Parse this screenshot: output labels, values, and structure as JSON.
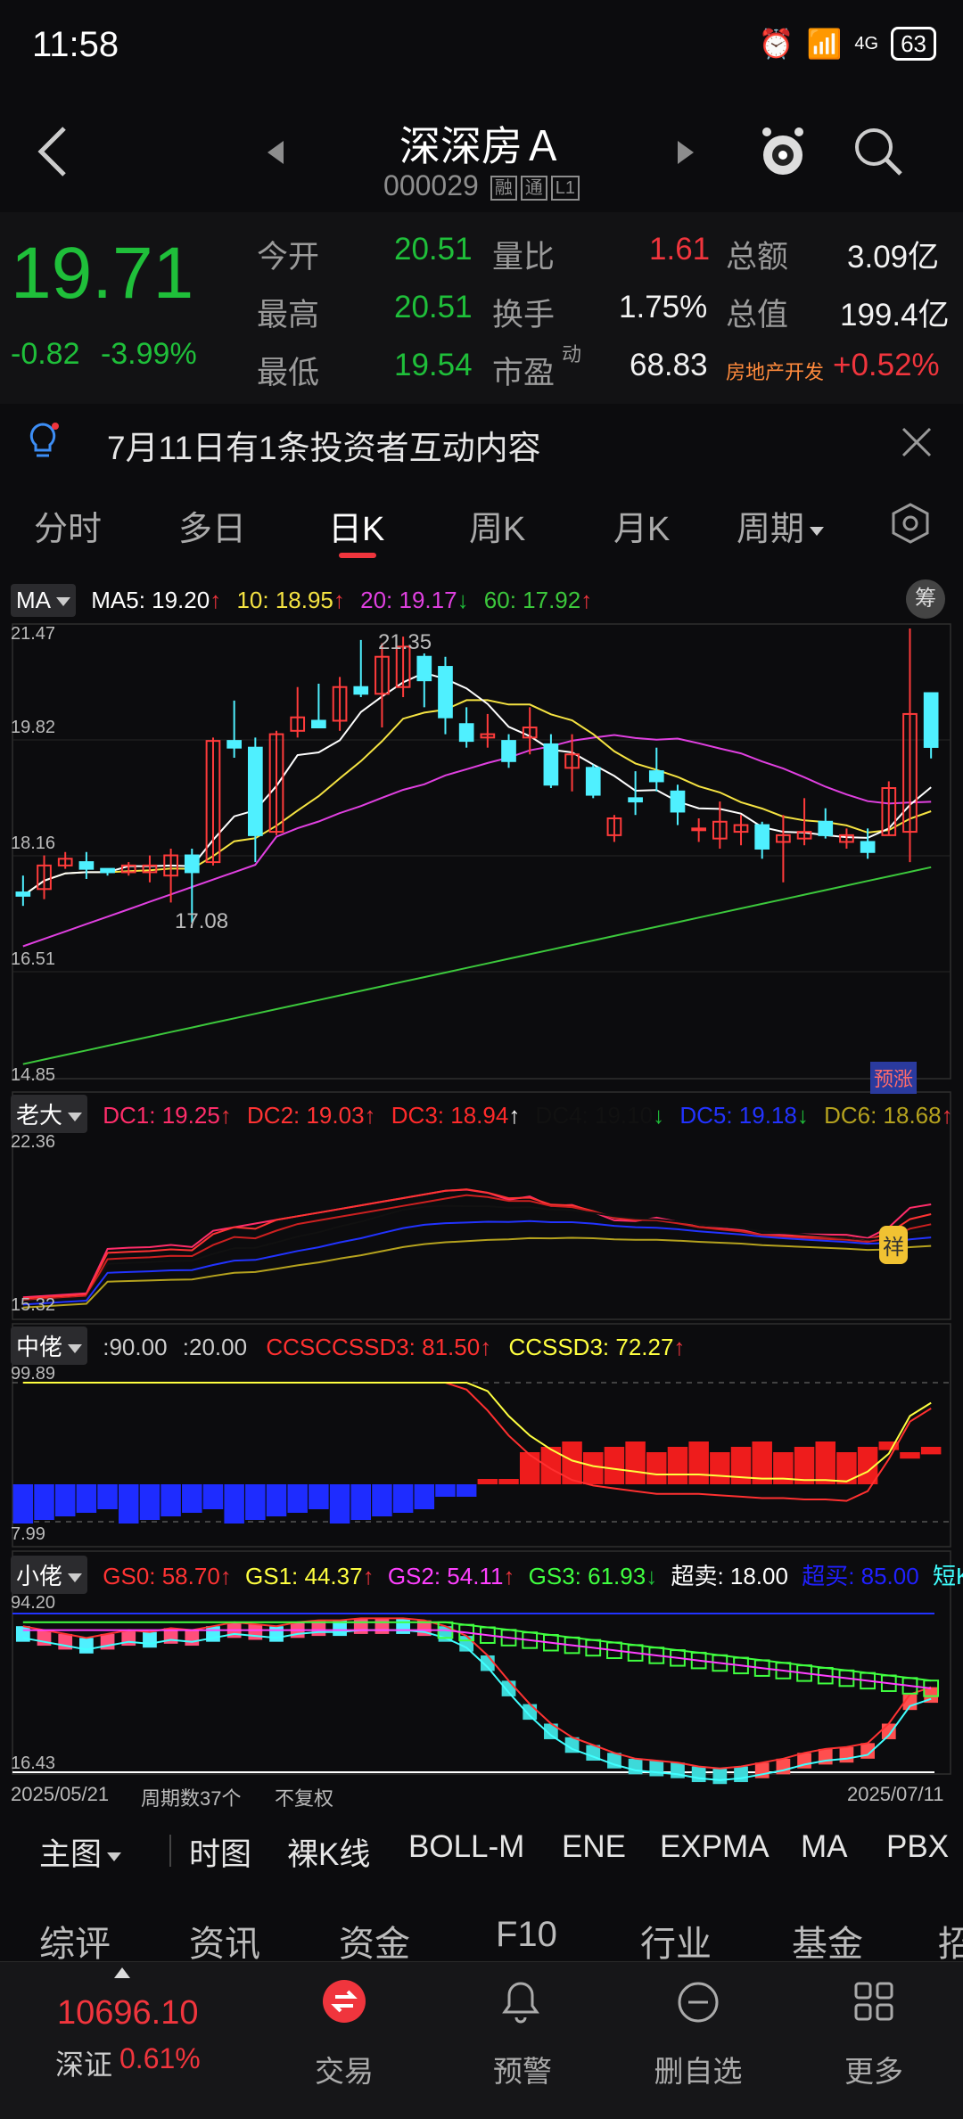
{
  "status_bar": {
    "time": "11:58",
    "network": "4G",
    "battery": "63"
  },
  "header": {
    "stock_name": "深深房Ａ",
    "stock_code": "000029",
    "tags": [
      "融",
      "通",
      "L1"
    ]
  },
  "quote": {
    "price": "19.71",
    "change": "-0.82",
    "change_pct": "-3.99%",
    "fields": [
      {
        "label": "今开",
        "value": "20.51",
        "color": "green"
      },
      {
        "label": "量比",
        "value": "1.61",
        "color": "red"
      },
      {
        "label": "总额",
        "value": "3.09亿",
        "color": "white"
      },
      {
        "label": "最高",
        "value": "20.51",
        "color": "green"
      },
      {
        "label": "换手",
        "value": "1.75%",
        "color": "white"
      },
      {
        "label": "总值",
        "value": "199.4亿",
        "color": "white"
      },
      {
        "label": "最低",
        "value": "19.54",
        "color": "green"
      },
      {
        "label": "市盈",
        "value": "68.83",
        "color": "white"
      }
    ],
    "pe_superscript": "动",
    "sector_label": "房地产开发",
    "sector_change": "+0.52%"
  },
  "notice": {
    "text": "7月11日有1条投资者互动内容"
  },
  "tabs": [
    "分时",
    "多日",
    "日K",
    "周K",
    "月K",
    "周期"
  ],
  "active_tab": "日K",
  "main_chart": {
    "selector": "MA",
    "indicators": [
      {
        "text": "MA5: 19.20",
        "arrow": "↑",
        "color": "#ffffff"
      },
      {
        "text": "10: 18.95",
        "arrow": "↑",
        "color": "#f5e342"
      },
      {
        "text": "20: 19.17",
        "arrow": "↓",
        "color": "#e040e0"
      },
      {
        "text": "60: 17.92",
        "arrow": "↑",
        "color": "#3cc83c"
      }
    ],
    "chip_label": "筹",
    "y_labels": [
      "21.47",
      "19.82",
      "18.16",
      "16.51",
      "14.85"
    ],
    "high_label": "21.35",
    "low_label": "17.08",
    "badge": "预涨"
  },
  "dc_chart": {
    "selector": "老大",
    "indicators": [
      {
        "text": "DC1: 19.25",
        "arrow": "↑",
        "color": "#ff2d6a"
      },
      {
        "text": "DC2: 19.03",
        "arrow": "↑",
        "color": "#ff3333"
      },
      {
        "text": "DC3: 18.94",
        "arrow": "↑",
        "color": "#ff2a2a"
      },
      {
        "text": "DC4: 19.10",
        "arrow": "↓",
        "color": "#111111"
      },
      {
        "text": "DC5: 19.18",
        "arrow": "↓",
        "color": "#2233ff"
      },
      {
        "text": "DC6: 18.68",
        "arrow": "↑",
        "color": "#b5a21e"
      }
    ],
    "y_labels": [
      "22.36",
      "15.32"
    ],
    "badge": "祥"
  },
  "cc_chart": {
    "selector": "中佬",
    "indicators": [
      {
        "text": ":90.00",
        "arrow": "",
        "color": "#cccccc"
      },
      {
        "text": ":20.00",
        "arrow": "",
        "color": "#cccccc"
      },
      {
        "text": "CCSCCSSD3: 81.50",
        "arrow": "↑",
        "color": "#ff3030"
      },
      {
        "text": "CCSSD3: 72.27",
        "arrow": "↑",
        "color": "#ffff40"
      }
    ],
    "y_labels": [
      "99.89",
      "7.99"
    ]
  },
  "gs_chart": {
    "selector": "小佬",
    "indicators": [
      {
        "text": "GS0: 58.70",
        "arrow": "↑",
        "color": "#ff3333"
      },
      {
        "text": "GS1: 44.37",
        "arrow": "↑",
        "color": "#ffff40"
      },
      {
        "text": "GS2: 54.11",
        "arrow": "↑",
        "color": "#ff40ff"
      },
      {
        "text": "GS3: 61.93",
        "arrow": "↓",
        "color": "#40ff40"
      },
      {
        "text": "超卖: 18.00",
        "arrow": "",
        "color": "#ffffff"
      },
      {
        "text": "超买: 85.00",
        "arrow": "",
        "color": "#2020ff"
      },
      {
        "text": "短K",
        "arrow": "",
        "color": "#40ffff"
      }
    ],
    "y_labels": [
      "94.20",
      "16.43"
    ]
  },
  "chart_footer": {
    "start_date": "2025/05/21",
    "period_count": "周期数37个",
    "adjust": "不复权",
    "end_date": "2025/07/11"
  },
  "indicator_bar": [
    "主图",
    "时图",
    "裸K线",
    "BOLL-M",
    "ENE",
    "EXPMA",
    "MA",
    "PBX"
  ],
  "active_indicator": "MA",
  "news_tabs": [
    "综评",
    "资讯",
    "资金",
    "F10",
    "行业",
    "基金",
    "招"
  ],
  "active_news_tab": "资讯",
  "bottom_nav": {
    "index_value": "10696.10",
    "index_name": "深证",
    "index_change": "0.61%",
    "items": [
      "交易",
      "预警",
      "删自选",
      "更多"
    ]
  },
  "chart_data": {
    "type": "candlestick",
    "title": "",
    "x_range": [
      "2025/05/21",
      "2025/07/11"
    ],
    "ylim": [
      14.85,
      21.47
    ],
    "candles": [
      [
        17.55,
        17.8,
        17.35,
        17.5
      ],
      [
        17.6,
        18.1,
        17.45,
        17.95
      ],
      [
        17.95,
        18.15,
        17.9,
        18.05
      ],
      [
        18.0,
        18.15,
        17.75,
        17.9
      ],
      [
        17.9,
        17.9,
        17.8,
        17.85
      ],
      [
        17.85,
        18.0,
        17.8,
        17.95
      ],
      [
        17.85,
        18.1,
        17.7,
        17.95
      ],
      [
        17.8,
        18.2,
        17.4,
        18.1
      ],
      [
        18.1,
        18.2,
        17.1,
        17.85
      ],
      [
        18.0,
        19.85,
        17.95,
        19.8
      ],
      [
        19.8,
        20.4,
        19.55,
        19.7
      ],
      [
        19.7,
        19.85,
        18.0,
        18.4
      ],
      [
        18.45,
        19.95,
        18.4,
        19.9
      ],
      [
        19.95,
        20.6,
        19.85,
        20.15
      ],
      [
        20.1,
        20.65,
        20.0,
        20.0
      ],
      [
        20.1,
        20.75,
        19.95,
        20.6
      ],
      [
        20.6,
        21.3,
        20.45,
        20.5
      ],
      [
        20.5,
        21.25,
        20.0,
        21.05
      ],
      [
        20.6,
        21.35,
        20.45,
        21.2
      ],
      [
        21.05,
        21.1,
        20.3,
        20.7
      ],
      [
        20.9,
        21.05,
        19.9,
        20.15
      ],
      [
        20.05,
        20.3,
        19.7,
        19.8
      ],
      [
        19.85,
        20.2,
        19.7,
        19.9
      ],
      [
        19.8,
        19.9,
        19.4,
        19.5
      ],
      [
        19.85,
        20.3,
        19.6,
        20.0
      ],
      [
        19.75,
        19.9,
        19.1,
        19.15
      ],
      [
        19.4,
        19.9,
        19.05,
        19.6
      ],
      [
        19.4,
        19.45,
        18.95,
        19.0
      ],
      [
        18.4,
        18.7,
        18.3,
        18.65
      ],
      [
        18.95,
        19.35,
        18.7,
        18.9
      ],
      [
        19.35,
        19.7,
        19.05,
        19.2
      ],
      [
        19.05,
        19.15,
        18.55,
        18.75
      ],
      [
        18.5,
        18.65,
        18.3,
        18.5
      ],
      [
        18.35,
        18.9,
        18.2,
        18.6
      ],
      [
        18.45,
        18.7,
        18.25,
        18.55
      ],
      [
        18.55,
        18.6,
        18.05,
        18.2
      ],
      [
        18.3,
        18.7,
        17.7,
        18.4
      ],
      [
        18.35,
        18.95,
        18.25,
        18.45
      ],
      [
        18.6,
        18.8,
        18.35,
        18.4
      ],
      [
        18.3,
        18.5,
        18.2,
        18.4
      ],
      [
        18.3,
        18.5,
        18.05,
        18.15
      ],
      [
        18.4,
        19.2,
        18.4,
        19.1
      ],
      [
        18.45,
        21.47,
        18.0,
        20.2
      ],
      [
        20.51,
        20.51,
        19.54,
        19.71
      ]
    ]
  }
}
